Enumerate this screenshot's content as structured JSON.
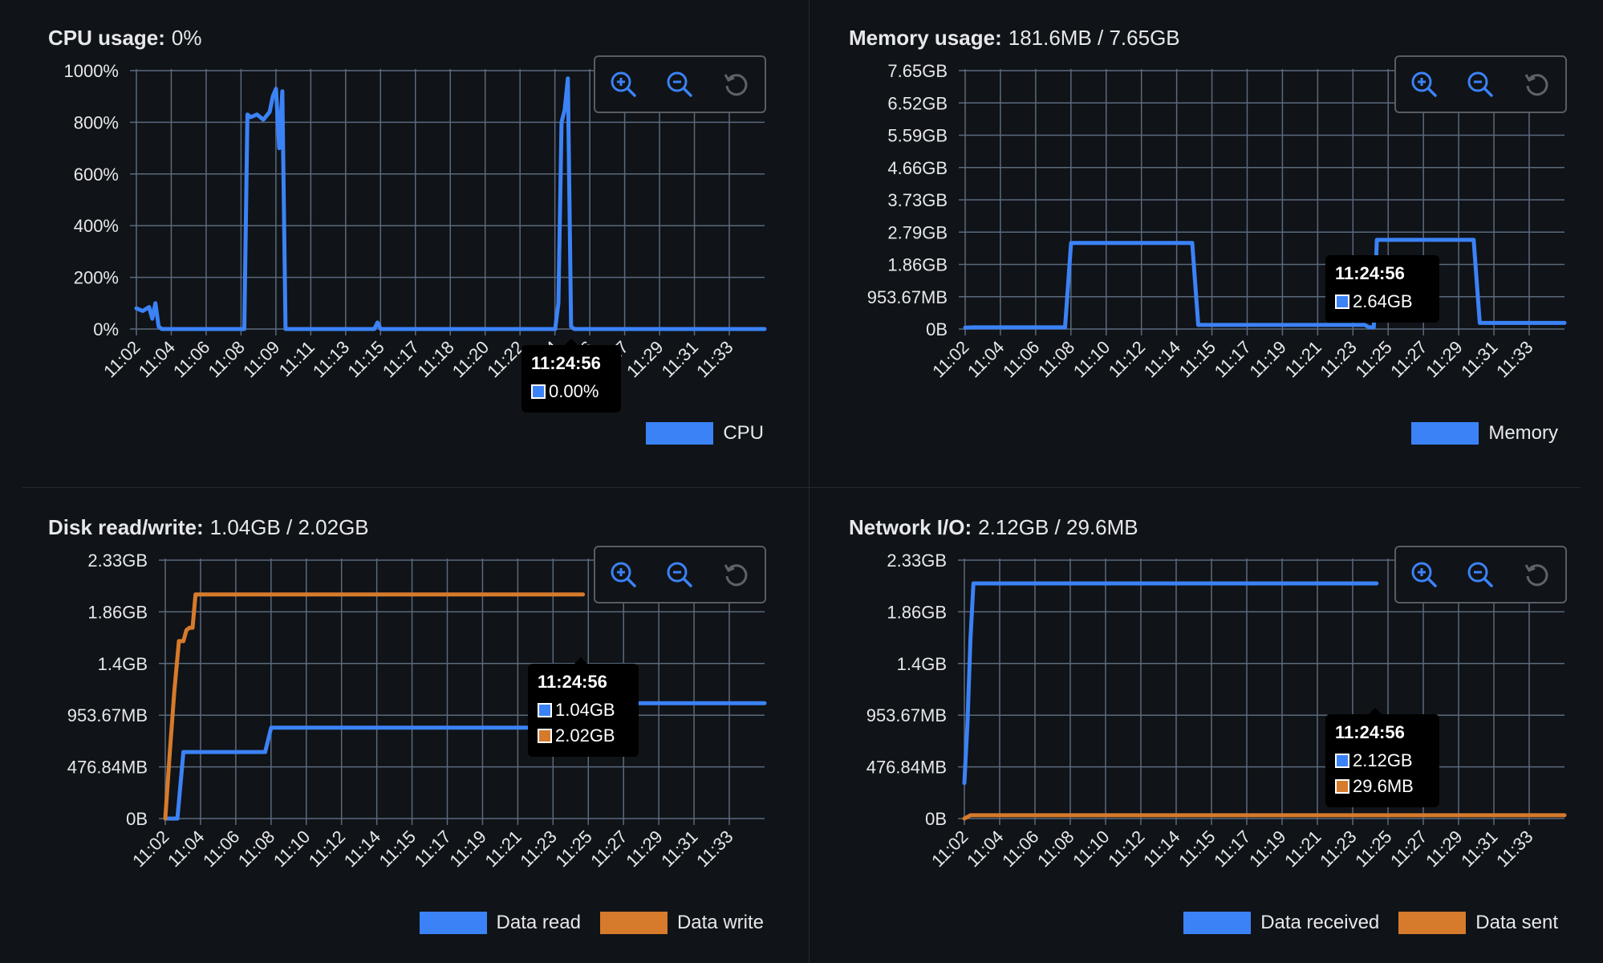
{
  "colors": {
    "blue": "#3b82f6",
    "orange": "#d67a2b",
    "grid": "#5a6a7e",
    "tick": "#e6e8eb",
    "background": "#101317"
  },
  "icons": {
    "zoom_in": "zoom-in-icon",
    "zoom_out": "zoom-out-icon",
    "reset": "reset-icon"
  },
  "panels": [
    {
      "title_label": "CPU usage:",
      "title_value": "0%",
      "tooltip": {
        "time": "11:24:56",
        "values": [
          "0.00%"
        ]
      },
      "legend": [
        "CPU"
      ]
    },
    {
      "title_label": "Memory usage:",
      "title_value": "181.6MB / 7.65GB",
      "tooltip": {
        "time": "11:24:56",
        "values": [
          "2.64GB"
        ]
      },
      "legend": [
        "Memory"
      ]
    },
    {
      "title_label": "Disk read/write:",
      "title_value": "1.04GB / 2.02GB",
      "tooltip": {
        "time": "11:24:56",
        "values": [
          "1.04GB",
          "2.02GB"
        ]
      },
      "legend": [
        "Data read",
        "Data write"
      ]
    },
    {
      "title_label": "Network I/O:",
      "title_value": "2.12GB / 29.6MB",
      "tooltip": {
        "time": "11:24:56",
        "values": [
          "2.12GB",
          "29.6MB"
        ]
      },
      "legend": [
        "Data received",
        "Data sent"
      ]
    }
  ],
  "chart_data": [
    {
      "type": "line",
      "title": "CPU usage:",
      "x_unit": "minutes",
      "x_range": [
        "11:02",
        "11:35"
      ],
      "x_ticks": [
        "11:02",
        "11:04",
        "11:06",
        "11:08",
        "11:09",
        "11:11",
        "11:13",
        "11:15",
        "11:17",
        "11:18",
        "11:20",
        "11:22",
        "11:24",
        "11:26",
        "11:27",
        "11:29",
        "11:31",
        "11:33"
      ],
      "y_ticks": [
        "0%",
        "200%",
        "400%",
        "600%",
        "800%",
        "1000%"
      ],
      "ylim": [
        0,
        1000
      ],
      "grid": true,
      "legend_position": "bottom-right",
      "series": [
        {
          "name": "CPU",
          "color": "blue",
          "x": [
            "11:02:00",
            "11:02:20",
            "11:02:40",
            "11:02:50",
            "11:03:00",
            "11:03:10",
            "11:03:20",
            "11:03:40",
            "11:07:40",
            "11:07:50",
            "11:08:00",
            "11:08:20",
            "11:08:40",
            "11:09:00",
            "11:09:10",
            "11:09:20",
            "11:09:30",
            "11:09:40",
            "11:09:50",
            "11:10:00",
            "11:10:10",
            "11:14:30",
            "11:14:40",
            "11:14:50",
            "11:24:00",
            "11:24:10",
            "11:24:20",
            "11:24:30",
            "11:24:40",
            "11:24:50",
            "11:25:00",
            "11:35:00"
          ],
          "values": [
            80,
            70,
            85,
            40,
            100,
            10,
            0,
            0,
            0,
            830,
            820,
            830,
            810,
            840,
            900,
            930,
            700,
            920,
            0,
            0,
            0,
            0,
            25,
            0,
            0,
            100,
            800,
            850,
            970,
            10,
            0,
            0
          ]
        }
      ]
    },
    {
      "type": "line",
      "title": "Memory usage:",
      "x_ticks": [
        "11:02",
        "11:04",
        "11:06",
        "11:08",
        "11:10",
        "11:12",
        "11:14",
        "11:15",
        "11:17",
        "11:19",
        "11:21",
        "11:23",
        "11:25",
        "11:27",
        "11:29",
        "11:31",
        "11:33"
      ],
      "y_ticks": [
        "0B",
        "953.67MB",
        "1.86GB",
        "2.79GB",
        "3.73GB",
        "4.66GB",
        "5.59GB",
        "6.52GB",
        "7.65GB"
      ],
      "ylim": [
        0,
        7.65
      ],
      "y_unit": "GB",
      "grid": true,
      "legend_position": "bottom-right",
      "series": [
        {
          "name": "Memory",
          "color": "blue",
          "x": [
            "11:02:00",
            "11:02:30",
            "11:07:30",
            "11:07:50",
            "11:14:30",
            "11:14:50",
            "11:24:00",
            "11:24:15",
            "11:24:30",
            "11:24:40",
            "11:30:00",
            "11:30:20",
            "11:35:00"
          ],
          "values": [
            0.04,
            0.05,
            0.05,
            2.55,
            2.55,
            0.12,
            0.12,
            0.05,
            0.05,
            2.64,
            2.64,
            0.18,
            0.18
          ]
        }
      ]
    },
    {
      "type": "line",
      "title": "Disk read/write:",
      "x_ticks": [
        "11:02",
        "11:04",
        "11:06",
        "11:08",
        "11:10",
        "11:12",
        "11:14",
        "11:15",
        "11:17",
        "11:19",
        "11:21",
        "11:23",
        "11:25",
        "11:27",
        "11:29",
        "11:31",
        "11:33"
      ],
      "y_ticks": [
        "0B",
        "476.84MB",
        "953.67MB",
        "1.4GB",
        "1.86GB",
        "2.33GB"
      ],
      "ylim": [
        0,
        2.33
      ],
      "y_unit": "GB",
      "grid": true,
      "legend_position": "bottom-right",
      "series": [
        {
          "name": "Data read",
          "color": "blue",
          "x": [
            "11:02:00",
            "11:02:40",
            "11:03:00",
            "11:07:30",
            "11:07:50",
            "11:25:00",
            "11:25:10",
            "11:35:00"
          ],
          "values": [
            0,
            0,
            0.6,
            0.6,
            0.82,
            0.82,
            1.04,
            1.04
          ]
        },
        {
          "name": "Data write",
          "color": "orange",
          "x": [
            "11:02:00",
            "11:02:15",
            "11:02:30",
            "11:02:45",
            "11:03:00",
            "11:03:10",
            "11:03:20",
            "11:03:30",
            "11:03:40",
            "11:25:00"
          ],
          "values": [
            0,
            0.6,
            1.15,
            1.6,
            1.6,
            1.7,
            1.72,
            1.72,
            2.02,
            2.02
          ]
        }
      ]
    },
    {
      "type": "line",
      "title": "Network I/O:",
      "x_ticks": [
        "11:02",
        "11:04",
        "11:06",
        "11:08",
        "11:10",
        "11:12",
        "11:14",
        "11:15",
        "11:17",
        "11:19",
        "11:21",
        "11:23",
        "11:25",
        "11:27",
        "11:29",
        "11:31",
        "11:33"
      ],
      "y_ticks": [
        "0B",
        "476.84MB",
        "953.67MB",
        "1.4GB",
        "1.86GB",
        "2.33GB"
      ],
      "ylim": [
        0,
        2.33
      ],
      "y_unit": "GB",
      "grid": true,
      "legend_position": "bottom-right",
      "series": [
        {
          "name": "Data received",
          "color": "blue",
          "x": [
            "11:02:00",
            "11:02:10",
            "11:02:20",
            "11:02:30",
            "11:02:40",
            "11:24:40"
          ],
          "values": [
            0.32,
            0.85,
            1.62,
            2.12,
            2.12,
            2.12
          ]
        },
        {
          "name": "Data sent",
          "color": "orange",
          "x": [
            "11:02:00",
            "11:02:20",
            "11:35:00"
          ],
          "values": [
            0,
            0.0296,
            0.0296
          ]
        }
      ]
    }
  ]
}
